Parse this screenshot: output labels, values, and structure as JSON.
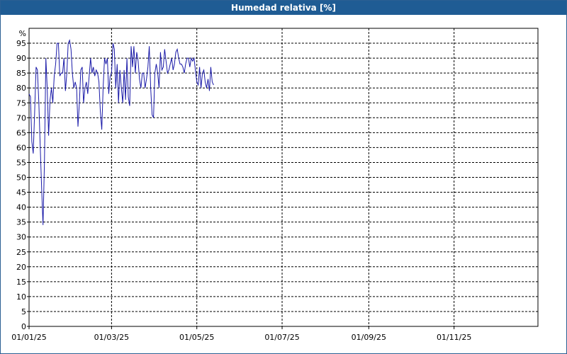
{
  "window": {
    "title": "Humedad relativa [%]"
  },
  "colors": {
    "title_bar": "#1f5c94",
    "line": "#1a1aa8",
    "grid": "#000000"
  },
  "chart_data": {
    "type": "line",
    "title": "Humedad relativa [%]",
    "ylabel": "%",
    "xlabel": "",
    "ylim": [
      0,
      100
    ],
    "yticks": [
      0,
      5,
      10,
      15,
      20,
      25,
      30,
      35,
      40,
      45,
      50,
      55,
      60,
      65,
      70,
      75,
      80,
      85,
      90,
      95
    ],
    "xlim": [
      "2025-01-01",
      "2025-12-31"
    ],
    "xtick_dates": [
      "2025-01-01",
      "2025-03-01",
      "2025-05-01",
      "2025-07-01",
      "2025-09-01",
      "2025-11-01"
    ],
    "xtick_labels": [
      "01/01/25",
      "01/03/25",
      "01/05/25",
      "01/07/25",
      "01/09/25",
      "01/11/25"
    ],
    "grid": true,
    "series": [
      {
        "x": [
          "2025-01-01",
          "2025-01-02",
          "2025-01-03",
          "2025-01-04",
          "2025-01-05",
          "2025-01-06",
          "2025-01-07",
          "2025-01-08",
          "2025-01-09",
          "2025-01-10",
          "2025-01-11",
          "2025-01-12",
          "2025-01-13",
          "2025-01-14",
          "2025-01-15",
          "2025-01-16",
          "2025-01-17",
          "2025-01-18",
          "2025-01-19",
          "2025-01-20",
          "2025-01-21",
          "2025-01-22",
          "2025-01-23",
          "2025-01-24",
          "2025-01-25",
          "2025-01-26",
          "2025-01-27",
          "2025-01-28",
          "2025-01-29",
          "2025-01-30",
          "2025-01-31",
          "2025-02-01",
          "2025-02-02",
          "2025-02-03",
          "2025-02-04",
          "2025-02-05",
          "2025-02-06",
          "2025-02-07",
          "2025-02-08",
          "2025-02-09",
          "2025-02-10",
          "2025-02-11",
          "2025-02-12",
          "2025-02-13",
          "2025-02-14",
          "2025-02-15",
          "2025-02-16",
          "2025-02-17",
          "2025-02-18",
          "2025-02-19",
          "2025-02-20",
          "2025-02-21",
          "2025-02-22",
          "2025-02-23",
          "2025-02-24",
          "2025-02-25",
          "2025-02-26",
          "2025-02-27",
          "2025-02-28",
          "2025-03-01",
          "2025-03-02",
          "2025-03-03",
          "2025-03-04",
          "2025-03-05",
          "2025-03-06",
          "2025-03-07",
          "2025-03-08",
          "2025-03-09",
          "2025-03-10",
          "2025-03-11",
          "2025-03-12",
          "2025-03-13",
          "2025-03-14",
          "2025-03-15",
          "2025-03-16",
          "2025-03-17",
          "2025-03-18",
          "2025-03-19",
          "2025-03-20",
          "2025-03-21",
          "2025-03-22",
          "2025-03-23",
          "2025-03-24",
          "2025-03-25",
          "2025-03-26",
          "2025-03-27",
          "2025-03-28",
          "2025-03-29",
          "2025-03-30",
          "2025-03-31",
          "2025-04-01",
          "2025-04-02",
          "2025-04-03",
          "2025-04-04",
          "2025-04-05",
          "2025-04-06",
          "2025-04-07",
          "2025-04-08",
          "2025-04-09",
          "2025-04-10",
          "2025-04-11",
          "2025-04-12",
          "2025-04-13",
          "2025-04-14",
          "2025-04-15",
          "2025-04-16",
          "2025-04-17",
          "2025-04-18",
          "2025-04-19",
          "2025-04-20",
          "2025-04-21",
          "2025-04-22",
          "2025-04-23",
          "2025-04-24",
          "2025-04-25",
          "2025-04-26",
          "2025-04-27",
          "2025-04-28",
          "2025-04-29",
          "2025-04-30",
          "2025-05-01",
          "2025-05-02",
          "2025-05-03",
          "2025-05-04",
          "2025-05-05",
          "2025-05-06",
          "2025-05-07",
          "2025-05-08",
          "2025-05-09",
          "2025-05-10",
          "2025-05-11",
          "2025-05-12",
          "2025-05-13"
        ],
        "values": [
          78,
          77,
          62,
          58,
          72,
          87,
          86,
          75,
          60,
          46,
          34,
          55,
          90,
          80,
          64,
          76,
          80,
          75,
          84,
          88,
          95,
          95,
          84,
          85,
          85,
          90,
          79,
          85,
          95,
          96,
          93,
          85,
          80,
          82,
          80,
          67,
          75,
          86,
          87,
          75,
          80,
          82,
          78,
          84,
          90,
          85,
          87,
          84,
          86,
          85,
          82,
          72,
          66,
          80,
          90,
          88,
          90,
          78,
          84,
          85,
          95,
          93,
          80,
          88,
          75,
          86,
          80,
          75,
          86,
          76,
          90,
          77,
          74,
          94,
          87,
          94,
          85,
          92,
          89,
          83,
          80,
          85,
          85,
          80,
          83,
          87,
          94,
          80,
          71,
          70,
          85,
          88,
          85,
          80,
          92,
          86,
          87,
          93,
          89,
          85,
          86,
          88,
          90,
          86,
          88,
          92,
          93,
          90,
          88,
          88,
          87,
          85,
          88,
          90,
          90,
          87,
          90,
          89,
          90,
          86,
          82,
          81,
          87,
          80,
          85,
          86,
          82,
          80,
          83,
          79,
          87,
          82,
          81
        ]
      }
    ]
  }
}
